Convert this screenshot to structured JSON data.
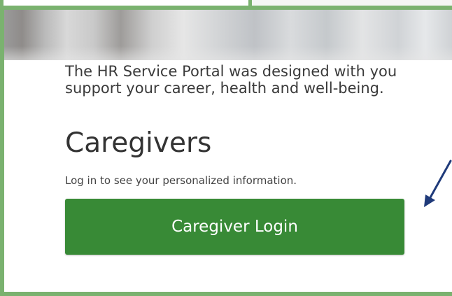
{
  "intro": {
    "line1": "The HR Service Portal was designed with you",
    "line2": "support your career, health and well-being."
  },
  "section": {
    "title": "Caregivers",
    "subtitle": "Log in to see your personalized information."
  },
  "login_button": {
    "label": "Caregiver Login"
  },
  "colors": {
    "accent": "#388a36",
    "frame": "#7ab26f",
    "arrow": "#1f3a7a"
  },
  "icons": {
    "annotation": "arrow-pointer-icon"
  }
}
